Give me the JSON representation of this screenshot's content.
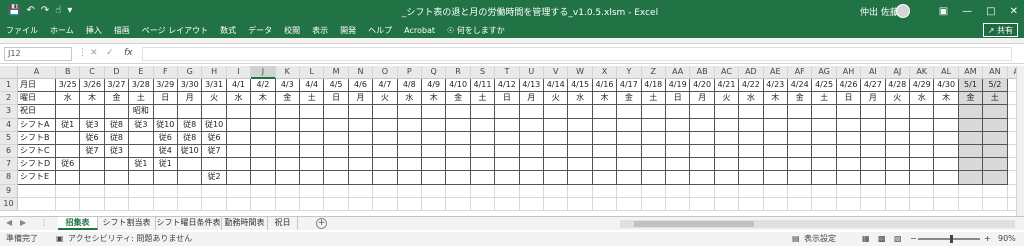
{
  "titlebar": {
    "title": "_シフト表の退と月の労働時間を管理する_v1.0.5.xlsm  -  Excel",
    "user": "仲出 佐藤",
    "icons": [
      "save-icon",
      "undo-icon",
      "redo-icon",
      "touch-mode-icon",
      "customize-icon"
    ]
  },
  "ribbon": {
    "tabs": [
      "ファイル",
      "ホーム",
      "挿入",
      "描画",
      "ページ レイアウト",
      "数式",
      "データ",
      "校閲",
      "表示",
      "開発",
      "ヘルプ",
      "Acrobat",
      "何をしますか"
    ],
    "share": "共有"
  },
  "formula_bar": {
    "name_box": "J12",
    "fx": "fx",
    "value": ""
  },
  "columns": [
    "A",
    "B",
    "C",
    "D",
    "E",
    "F",
    "G",
    "H",
    "I",
    "J",
    "K",
    "L",
    "M",
    "N",
    "O",
    "P",
    "Q",
    "R",
    "S",
    "T",
    "U",
    "V",
    "W",
    "X",
    "Y",
    "Z",
    "AA",
    "AB",
    "AC",
    "AD",
    "AE",
    "AF",
    "AG",
    "AH",
    "AI",
    "AJ",
    "AK",
    "AL",
    "AM",
    "AN",
    "AO"
  ],
  "rows": [
    "1",
    "2",
    "3",
    "4",
    "5",
    "6",
    "7",
    "8",
    "9",
    "10"
  ],
  "sheet": {
    "labels": [
      "月日",
      "曜日",
      "祝日",
      "シフトA",
      "シフトB",
      "シフトC",
      "シフトD",
      "シフトE"
    ],
    "dates": [
      "3/25",
      "3/26",
      "3/27",
      "3/28",
      "3/29",
      "3/30",
      "3/31",
      "4/1",
      "4/2",
      "4/3",
      "4/4",
      "4/5",
      "4/6",
      "4/7",
      "4/8",
      "4/9",
      "4/10",
      "4/11",
      "4/12",
      "4/13",
      "4/14",
      "4/15",
      "4/16",
      "4/17",
      "4/18",
      "4/19",
      "4/20",
      "4/21",
      "4/22",
      "4/23",
      "4/24",
      "4/25",
      "4/26",
      "4/27",
      "4/28",
      "4/29",
      "4/30",
      "5/1",
      "5/2"
    ],
    "weekdays": [
      "水",
      "木",
      "金",
      "土",
      "日",
      "月",
      "火",
      "水",
      "木",
      "金",
      "土",
      "日",
      "月",
      "火",
      "水",
      "木",
      "金",
      "土",
      "日",
      "月",
      "火",
      "水",
      "木",
      "金",
      "土",
      "日",
      "月",
      "火",
      "水",
      "木",
      "金",
      "土",
      "日",
      "月",
      "火",
      "水",
      "木",
      "金",
      "土"
    ],
    "holiday_row": [
      "",
      "",
      "",
      "昭和",
      "",
      "",
      "",
      "",
      "",
      "",
      "",
      "",
      "",
      "",
      "",
      "",
      "",
      "",
      "",
      "",
      "",
      "",
      "",
      "",
      "",
      "",
      "",
      "",
      "",
      "",
      "",
      "",
      "",
      "",
      "",
      "",
      "",
      "",
      ""
    ],
    "shiftA": [
      "従1",
      "従3",
      "従8",
      "従3",
      "従10",
      "従8",
      "従10"
    ],
    "shiftB": [
      "",
      "従6",
      "従8",
      "",
      "従6",
      "従8",
      "従6"
    ],
    "shiftC": [
      "",
      "従7",
      "従3",
      "",
      "従4",
      "従10",
      "従7"
    ],
    "shiftD": [
      "従6",
      "",
      "",
      "従1",
      "従1",
      "",
      ""
    ],
    "shiftE": [
      "",
      "",
      "",
      "",
      "",
      "",
      "従2"
    ]
  },
  "sheet_tabs": [
    "招集表",
    "シフト割当表",
    "シフト曜日条件表",
    "勤務時間表",
    "祝日"
  ],
  "status": {
    "ready": "準備完了",
    "accessibility": "アクセシビリティ: 問題ありません",
    "display_settings": "表示設定",
    "zoom": "90%"
  }
}
